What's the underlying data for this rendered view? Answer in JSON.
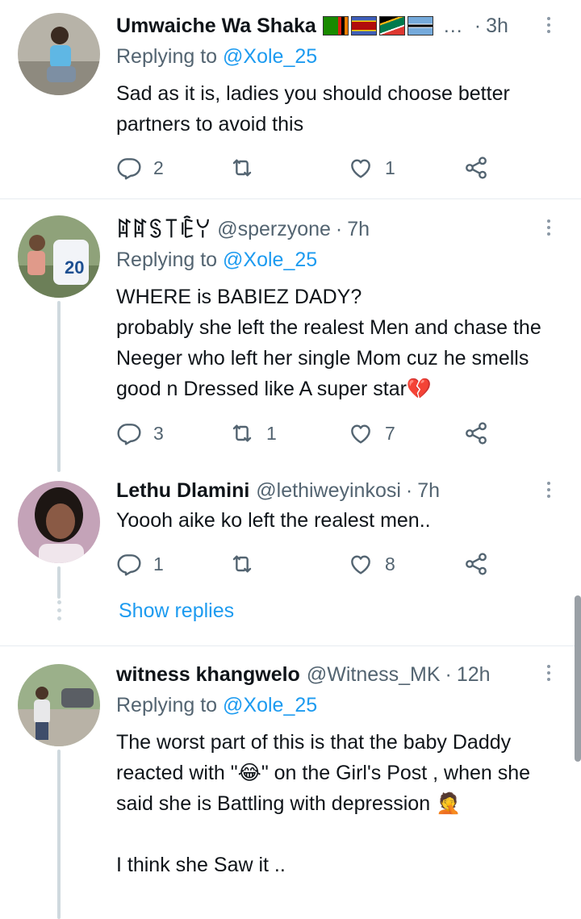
{
  "tweets": [
    {
      "name": "Umwaiche Wa Shaka",
      "handle": "",
      "truncation": "…",
      "time": "3h",
      "replying_prefix": "Replying to",
      "replying_to": "@Xole_25",
      "text": "Sad as it is, ladies you should choose better partners to avoid this",
      "replies": "2",
      "retweets": "",
      "likes": "1"
    },
    {
      "name": "ꍏꍏꌗ꓄ꍟꌩ",
      "handle": "@sperzyone",
      "time": "7h",
      "replying_prefix": "Replying to",
      "replying_to": "@Xole_25",
      "text": "WHERE is BABIEZ DADY?\nprobably she left the realest Men and chase the Neeger who left her single Mom cuz he smells good n Dressed like A super star💔",
      "replies": "3",
      "retweets": "1",
      "likes": "7"
    },
    {
      "name": "Lethu Dlamini",
      "handle": "@lethiweyinkosi",
      "time": "7h",
      "text": "Yoooh aike ko left the realest men..",
      "replies": "1",
      "retweets": "",
      "likes": "8"
    },
    {
      "name": "witness khangwelo",
      "handle": "@Witness_MK",
      "time": "12h",
      "replying_prefix": "Replying to",
      "replying_to": "@Xole_25",
      "text": "The worst part of this is that the  baby Daddy  reacted with \"😂\" on the Girl's Post , when she said  she is Battling with depression 🤦\n\nI think she Saw it .."
    }
  ],
  "show_replies_label": "Show replies",
  "dot_separator": "·",
  "colors": {
    "link": "#1d9bf0",
    "secondary_text": "#536471",
    "thread_line": "#cfd9de"
  },
  "icons": [
    "reply-icon",
    "retweet-icon",
    "like-icon",
    "share-icon",
    "more-icon"
  ]
}
